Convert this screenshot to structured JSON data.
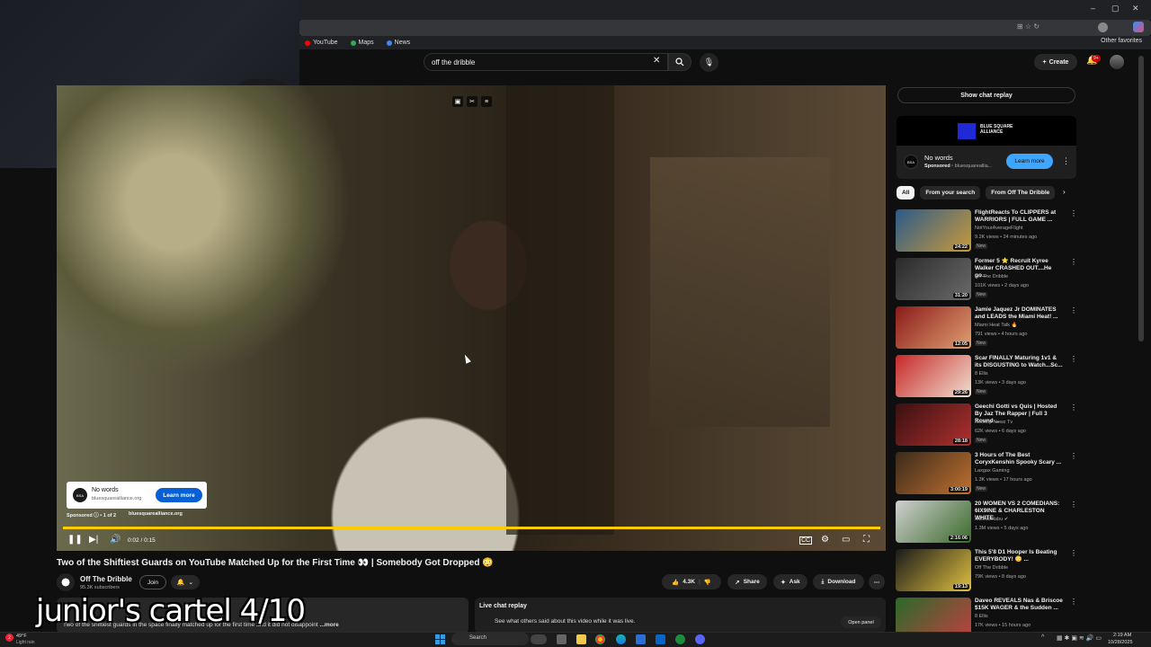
{
  "browser": {
    "bookmarks": [
      {
        "label": "YouTube",
        "color": "#ff0000"
      },
      {
        "label": "Maps",
        "color": "#34a853"
      },
      {
        "label": "News",
        "color": "#4285f4"
      }
    ],
    "other_favorites": "Other favorites"
  },
  "header": {
    "search_value": "off the dribble",
    "create_label": "Create",
    "notification_count": "9+"
  },
  "player": {
    "ad": {
      "title": "No words",
      "domain": "bluesquarealliance.org",
      "cta": "Learn more",
      "sponsored": "Sponsored ⓘ • 1 of 2",
      "sponsored_domain": "bluesquarealliance.org"
    },
    "time": "0:02 / 0:15",
    "progress": 0.13
  },
  "video": {
    "title": "Two of the Shiftiest Guards on YouTube Matched Up for the First Time 👀 | Somebody Got Dropped 😳",
    "channel": "Off The Dribble",
    "subscribers": "95.3K subscribers",
    "join_label": "Join",
    "likes": "4.3K",
    "share_label": "Share",
    "ask_label": "Ask",
    "download_label": "Download",
    "description": "Two of the shiftiest guards in the space finally matched up for the first time and it did not disappoint",
    "more_label": "...more"
  },
  "live_chat": {
    "title": "Live chat replay",
    "subtitle": "See what others said about this video while it was live.",
    "open_panel": "Open panel"
  },
  "stream_overlay": "junior's cartel 4/10",
  "sidebar": {
    "show_chat_replay": "Show chat replay",
    "ad": {
      "brand": "BLUE SQUARE ALLIANCE",
      "title": "No words",
      "sponsored": "Sponsored",
      "domain": "bluesquareallia...",
      "cta": "Learn more"
    },
    "chips": [
      "All",
      "From your search",
      "From Off The Dribble"
    ],
    "recommendations": [
      {
        "title": "FlightReacts To CLIPPERS at WARRIORS | FULL GAME ...",
        "channel": "NotYourAverageFlight",
        "meta": "9.2K views • 24 minutes ago",
        "badge": "New",
        "duration": "24:22",
        "colors": [
          "#2b5a8a",
          "#c99a3a"
        ]
      },
      {
        "title": "Former 5 ⭐ Recruit Kyree Walker CRASHED OUT....He go...",
        "channel": "Off The Dribble",
        "meta": "101K views • 2 days ago",
        "badge": "New",
        "duration": "31:20",
        "colors": [
          "#2a2a2a",
          "#6a6a6a"
        ]
      },
      {
        "title": "Jamie Jaquez Jr DOMINATES and LEADS the Miami Heat! ...",
        "channel": "Miami Heat Talk 🔥",
        "meta": "791 views • 4 hours ago",
        "badge": "New",
        "duration": "12:05",
        "colors": [
          "#8a1a1a",
          "#e0a070"
        ]
      },
      {
        "title": "Scar FINALLY Maturing 1v1 & its DISGUSTING to Watch...Sc...",
        "channel": "8 Ellis",
        "meta": "13K views • 3 days ago",
        "badge": "New",
        "duration": "29:26",
        "colors": [
          "#c62828",
          "#f0e0d0"
        ]
      },
      {
        "title": "Geechi Gotti vs Quis | Hosted By Jaz The Rapper | Full 3 Round ...",
        "channel": "Rooftop Newz Tv",
        "meta": "62K views • 6 days ago",
        "badge": "New",
        "duration": "28:18",
        "colors": [
          "#3a1010",
          "#b03030"
        ]
      },
      {
        "title": "3 Hours of The Best CoryxKenshin Spooky Scary ...",
        "channel": "Laxgax Gaming",
        "meta": "1.3K views • 17 hours ago",
        "badge": "New",
        "duration": "3:00:19",
        "colors": [
          "#3a2a1a",
          "#c07030"
        ]
      },
      {
        "title": "20 WOMEN VS 2 COMEDIANS: 6IX9INE & CHARLESTON WHITE",
        "channel": "Mikeadelabu ✔",
        "meta": "1.3M views • 5 days ago",
        "badge": "",
        "duration": "2:16:06",
        "colors": [
          "#d0d0d0",
          "#3a6a2a"
        ]
      },
      {
        "title": "This 5'8 D1 Hooper Is Beating EVERYBODY! 😳 ...",
        "channel": "Off The Dribble",
        "meta": "79K views • 8 days ago",
        "badge": "",
        "duration": "19:13",
        "colors": [
          "#1a1a1a",
          "#e0c040"
        ]
      },
      {
        "title": "Daveo REVEALS Nas & Briscoe $15K WAGER & the Sudden ...",
        "channel": "8 Ellis",
        "meta": "17K views • 15 hours ago",
        "badge": "",
        "duration": "",
        "colors": [
          "#2a6a2a",
          "#c04040"
        ]
      }
    ]
  },
  "taskbar": {
    "temp": "49°F",
    "weather": "Light rain",
    "search_placeholder": "Search",
    "time": "2:19 AM",
    "date": "10/28/2025"
  }
}
